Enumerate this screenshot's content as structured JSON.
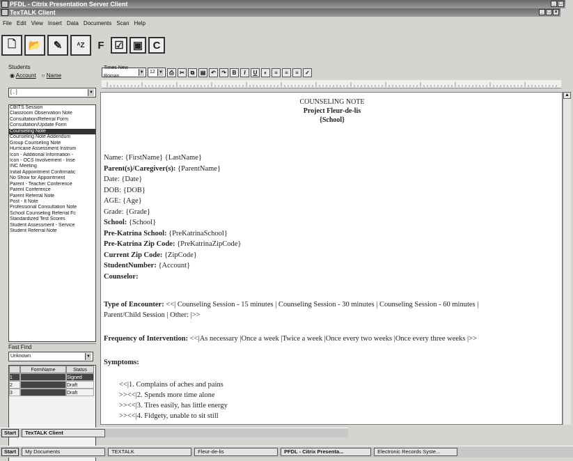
{
  "window": {
    "outer_title": "PFDL - Citrix Presentation Server Client",
    "inner_title": "TextTALK Client",
    "inner_title_alt": "TexTALK Client"
  },
  "menu": [
    "File",
    "Edit",
    "View",
    "Insert",
    "Data",
    "Documents",
    "Scan",
    "Help"
  ],
  "toolbar_glyphs": [
    "🗋",
    "📂",
    "✎",
    "ᴬZ",
    "F",
    "☑",
    "▣",
    "C"
  ],
  "students": {
    "label": "Students",
    "radio_account": "Account",
    "radio_name": "Name",
    "selected": "[ , ]"
  },
  "note_types": [
    "CBITS Session",
    "Classroom Observation Note",
    "Consultation/Referral Form",
    "Consultation/Update Form",
    "Counseling Note",
    "Counseling Note Addendum",
    "Group Counseling Note",
    "Hurricane Assessment Instrum",
    "Icon - Additional Information -",
    "Icon - OCS Involvement - Inse",
    "INC Meeting",
    "Initial Appointment Confirmatic",
    "No Show for Appointment",
    "Parent - Teacher Conference",
    "Parent Conference",
    "Parent Referral Note",
    "Post - It Note",
    "Professional Consultation Note",
    "School Counseling Referral Fc",
    "Standardized Test Scores",
    "Student Assessment - Service",
    "Student Referral Note"
  ],
  "selected_note_index": 4,
  "fast_find": {
    "label": "Fast Find",
    "value": "Unknown"
  },
  "grid": {
    "headers": [
      "FormName",
      "Status"
    ],
    "rows": [
      {
        "num": "1",
        "form": "",
        "status": "Signed"
      },
      {
        "num": "2",
        "form": "",
        "status": "Draft"
      },
      {
        "num": "3",
        "form": "",
        "status": "Draft"
      }
    ]
  },
  "format": {
    "font": "Times New Roman",
    "size": "12",
    "bold": "B",
    "italic": "I",
    "underline": "U"
  },
  "doc": {
    "title": "COUNSELING NOTE",
    "subtitle": "Project Fleur-de-lis",
    "school_line": "{School}",
    "fields": [
      {
        "label": "Name:",
        "value": "{FirstName} {LastName}",
        "bold": false
      },
      {
        "label": "Parent(s)/Caregiver(s):",
        "value": "{ParentName}",
        "bold": true
      },
      {
        "label": "Date:",
        "value": "{Date}",
        "bold": false
      },
      {
        "label": "DOB:",
        "value": "{DOB}",
        "bold": false
      },
      {
        "label": "AGE:",
        "value": "{Age}",
        "bold": false
      },
      {
        "label": "Grade:",
        "value": "{Grade}",
        "bold": false
      },
      {
        "label": "School:",
        "value": "{School}",
        "bold": true
      },
      {
        "label": "Pre-Katrina School:",
        "value": "{PreKatrinaSchool}",
        "bold": true
      },
      {
        "label": "Pre-Katrina Zip Code:",
        "value": "{PreKatrinaZipCode}",
        "bold": true
      },
      {
        "label": "Current Zip Code:",
        "value": "{ZipCode}",
        "bold": true
      },
      {
        "label": "StudentNumber:",
        "value": "{Account}",
        "bold": true
      },
      {
        "label": "Counselor:",
        "value": "",
        "bold": true
      }
    ],
    "encounter_label": "Type of Encounter:",
    "encounter_text": "<<| Counseling Session - 15 minutes | Counseling Session - 30 minutes | Counseling Session - 60 minutes |",
    "encounter_text2": "Parent/Child Session | Other: |>>",
    "frequency_label": "Frequency of Intervention:",
    "frequency_text": "<<|As necessary |Once a week |Twice a week |Once every two weeks |Once every three weeks |>>",
    "symptoms_label": "Symptoms:",
    "symptoms": [
      "<<|1.   Complains of aches and pains",
      ">><<|2.   Spends more time alone",
      ">><<|3.      Tires easily, has little energy",
      ">><<|4.      Fidgety, unable to sit still"
    ]
  },
  "taskbar_inner": {
    "start": "Start",
    "app": "TexTALK Client"
  },
  "taskbar_outer": {
    "start": "Start",
    "tasks": [
      "My Documents",
      "TEXTALK",
      "Fleur-de-lis",
      "PFDL - Citrix Presenta...",
      "Electronic Records Syste..."
    ]
  }
}
